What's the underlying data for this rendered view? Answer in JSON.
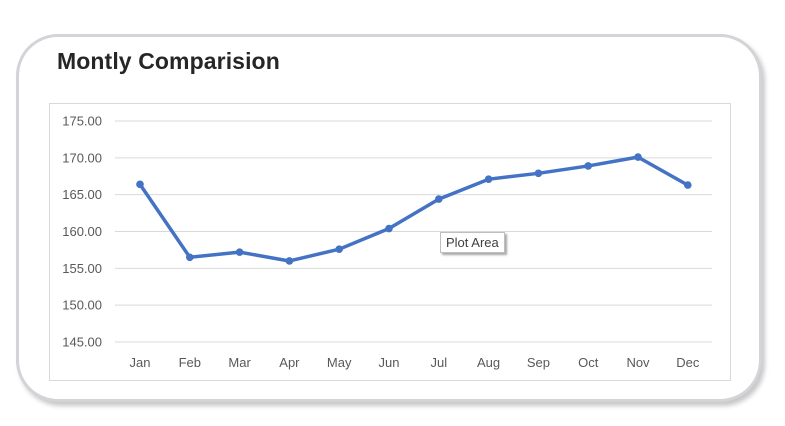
{
  "chart_data": {
    "type": "line",
    "title": "Montly Comparision",
    "categories": [
      "Jan",
      "Feb",
      "Mar",
      "Apr",
      "May",
      "Jun",
      "Jul",
      "Aug",
      "Sep",
      "Oct",
      "Nov",
      "Dec"
    ],
    "series": [
      {
        "values": [
          166.4,
          156.5,
          157.2,
          156.0,
          157.6,
          160.4,
          164.4,
          167.1,
          167.9,
          168.9,
          170.1,
          166.3
        ]
      }
    ],
    "ylim": [
      145,
      175
    ],
    "y_ticks": [
      "145.00",
      "150.00",
      "155.00",
      "160.00",
      "165.00",
      "170.00",
      "175.00"
    ],
    "xlabel": "",
    "ylabel": "",
    "grid": true,
    "legend": "none",
    "line_color": "#4472C4"
  },
  "tooltip": {
    "text": "Plot Area"
  }
}
